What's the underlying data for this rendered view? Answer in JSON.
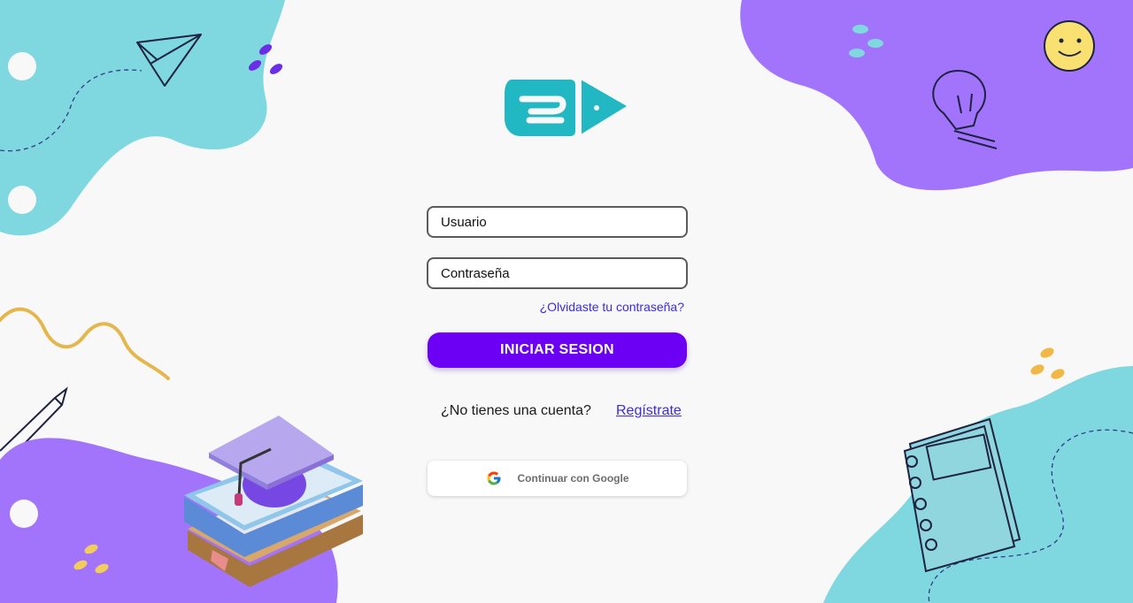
{
  "login_form": {
    "username_placeholder": "Usuario",
    "password_placeholder": "Contraseña",
    "forgot_password": "¿Olvidaste tu contraseña?",
    "submit_label": "INICIAR SESION"
  },
  "signup": {
    "question": "¿No tienes una cuenta?",
    "link": "Regístrate"
  },
  "google": {
    "label": "Continuar con Google",
    "icon": "google-g-icon"
  },
  "colors": {
    "primary": "#6b00f5",
    "link": "#3b2ae6",
    "teal": "#7fd8df",
    "purple": "#a274fb",
    "logo": "#21b8c4"
  }
}
